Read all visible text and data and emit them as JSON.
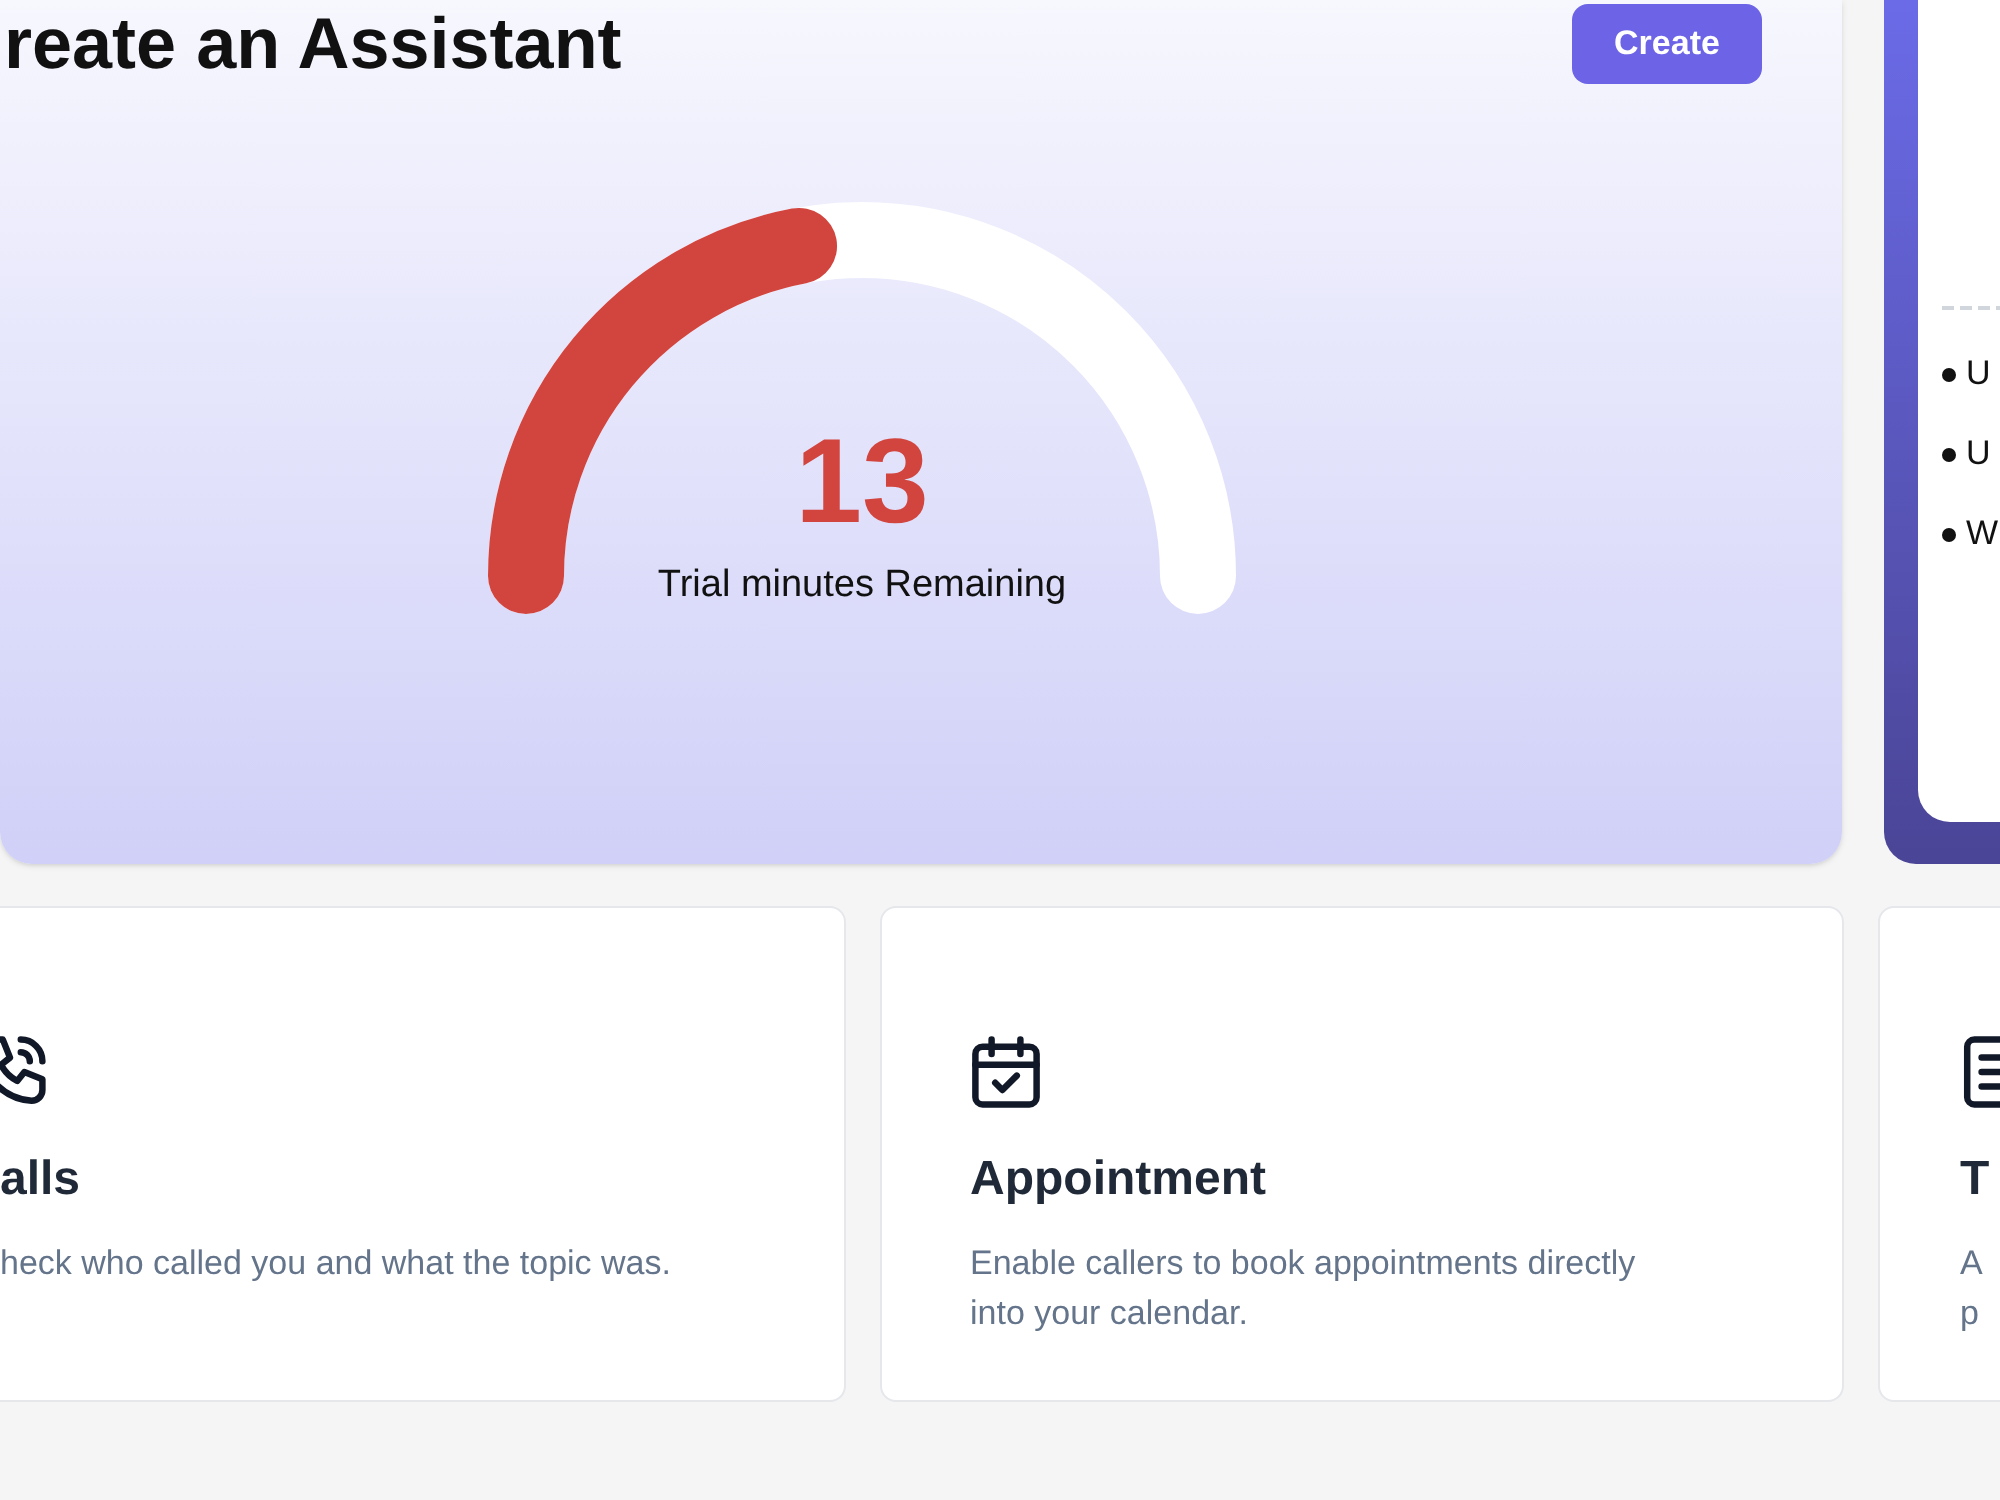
{
  "header": {
    "title": "reate an Assistant",
    "button": "Create"
  },
  "gauge": {
    "level": 0.44,
    "value": "13",
    "label": "Trial minutes Remaining"
  },
  "side_panel": {
    "bullets": [
      "U",
      "U",
      "W"
    ]
  },
  "features": [
    {
      "kind": "phone",
      "title": "alls",
      "description_lines": [
        "heck who called you and what the topic was."
      ]
    },
    {
      "kind": "calendar",
      "title": "Appointment",
      "description_lines": [
        "Enable callers to book appointments directly",
        "into your calendar."
      ]
    },
    {
      "kind": "document",
      "title": "T",
      "description_lines": [
        "A",
        "p"
      ]
    }
  ]
}
